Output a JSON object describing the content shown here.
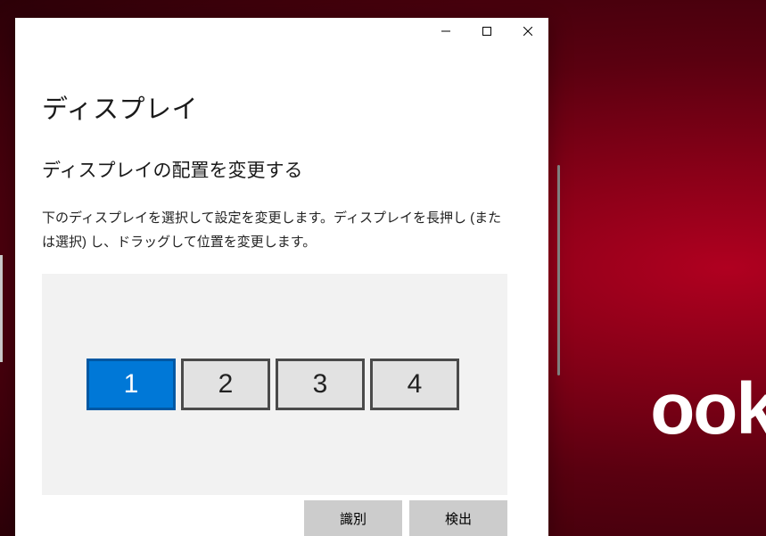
{
  "desktop": {
    "background_text": "ook"
  },
  "window": {
    "page_title": "ディスプレイ",
    "section_title": "ディスプレイの配置を変更する",
    "help_text": "下のディスプレイを選択して設定を変更します。ディスプレイを長押し (または選択) し、ドラッグして位置を変更します。",
    "monitors": [
      {
        "label": "1",
        "primary": true
      },
      {
        "label": "2",
        "primary": false
      },
      {
        "label": "3",
        "primary": false
      },
      {
        "label": "4",
        "primary": false
      }
    ],
    "buttons": {
      "identify": "識別",
      "detect": "検出"
    }
  }
}
